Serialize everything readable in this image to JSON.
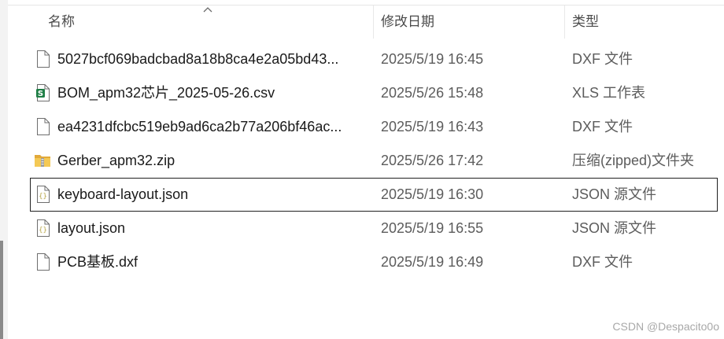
{
  "columns": {
    "name": "名称",
    "date": "修改日期",
    "type": "类型"
  },
  "files": [
    {
      "name": "5027bcf069badcbad8a18b8ca4e2a05bd43...",
      "date": "2025/5/19 16:45",
      "type": "DXF 文件",
      "icon": "document-icon"
    },
    {
      "name": "BOM_apm32芯片_2025-05-26.csv",
      "date": "2025/5/26 15:48",
      "type": "XLS 工作表",
      "icon": "spreadsheet-icon"
    },
    {
      "name": "ea4231dfcbc519eb9ad6ca2b77a206bf46ac...",
      "date": "2025/5/19 16:43",
      "type": "DXF 文件",
      "icon": "document-icon"
    },
    {
      "name": "Gerber_apm32.zip",
      "date": "2025/5/26 17:42",
      "type": "压缩(zipped)文件夹",
      "icon": "zip-folder-icon"
    },
    {
      "name": "keyboard-layout.json",
      "date": "2025/5/19 16:30",
      "type": "JSON 源文件",
      "icon": "json-file-icon"
    },
    {
      "name": "layout.json",
      "date": "2025/5/19 16:55",
      "type": "JSON 源文件",
      "icon": "json-file-icon"
    },
    {
      "name": "PCB基板.dxf",
      "date": "2025/5/19 16:49",
      "type": "DXF 文件",
      "icon": "document-icon"
    }
  ],
  "watermark": "CSDN @Despacito0o",
  "colors": {
    "spreadsheet_green": "#1e7e45",
    "zip_yellow": "#f0c24a",
    "json_brace": "#b8a64a"
  }
}
